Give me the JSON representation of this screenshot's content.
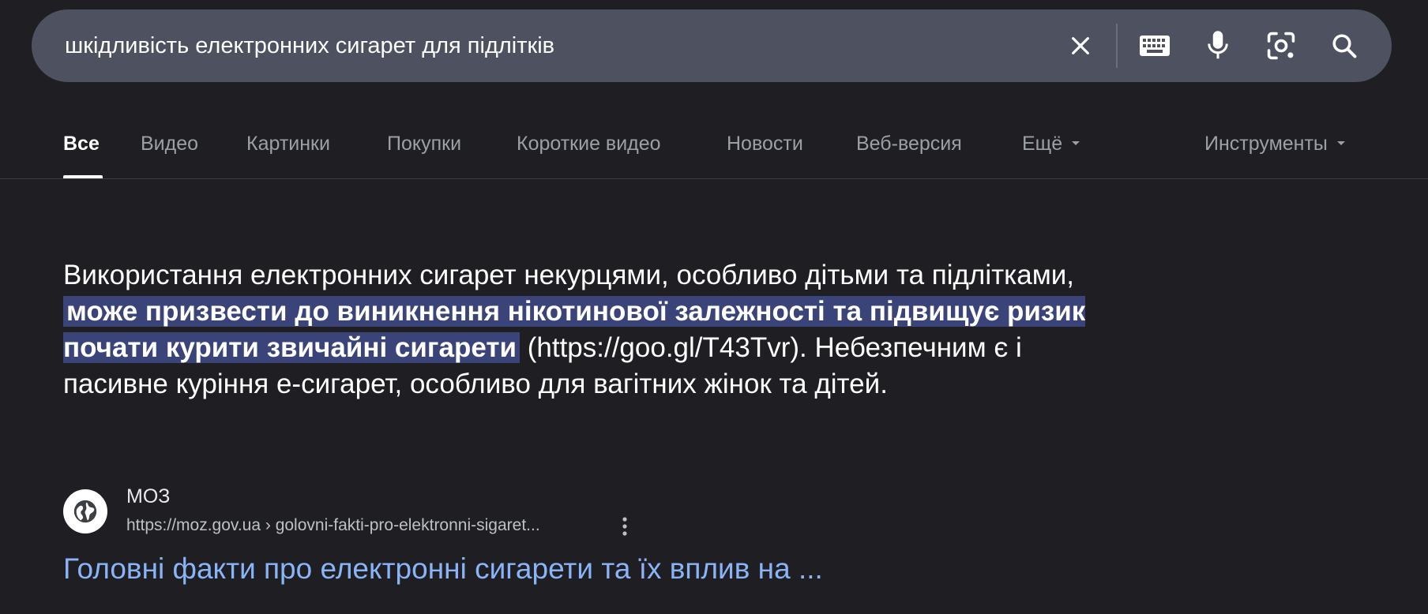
{
  "search": {
    "query": "шкідливість електронних сигарет для підлітків",
    "icons": [
      "close-icon",
      "keyboard-icon",
      "microphone-icon",
      "lens-icon",
      "search-icon"
    ]
  },
  "tabs": {
    "items": [
      {
        "label": "Все",
        "active": true
      },
      {
        "label": "Видео"
      },
      {
        "label": "Картинки"
      },
      {
        "label": "Покупки"
      },
      {
        "label": "Короткие видео"
      },
      {
        "label": "Новости"
      },
      {
        "label": "Веб-версия"
      },
      {
        "label": "Ещё"
      }
    ],
    "tools_label": "Инструменты"
  },
  "snippet": {
    "part1": "Використання електронних сигарет некурцями, особливо дітьми та підлітками, ",
    "highlight": "може призвести до виникнення нікотинової залежності та підвищує ризик почати курити звичайні сигарети",
    "part2": " (https://goo.gl/T43Tvr). Небезпечним є і пасивне куріння е-сигарет, особливо для вагітних жінок та дітей."
  },
  "result": {
    "source_name": "МОЗ",
    "url": "https://moz.gov.ua › golovni-fakti-pro-elektronni-sigaret...",
    "title": "Головні факти про електронні сигарети та їх вплив на ..."
  },
  "colors": {
    "background": "#1f1f23",
    "search_bar": "#4d5160",
    "highlight": "#3b4478",
    "link": "#8ab4f8"
  }
}
